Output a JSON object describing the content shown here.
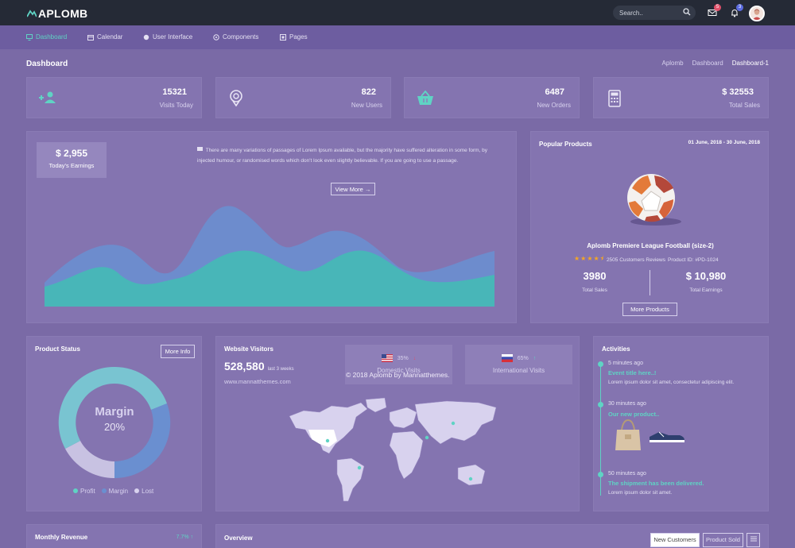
{
  "brand": {
    "name": "APLOMB"
  },
  "search": {
    "placeholder": "Search.."
  },
  "notifications": {
    "mail_count": "5",
    "bell_count": "3"
  },
  "nav": [
    {
      "label": "Dashboard",
      "icon": "monitor-icon"
    },
    {
      "label": "Calendar",
      "icon": "calendar-icon"
    },
    {
      "label": "User Interface",
      "icon": "circle-icon"
    },
    {
      "label": "Components",
      "icon": "gauge-icon"
    },
    {
      "label": "Pages",
      "icon": "pages-icon"
    }
  ],
  "page": {
    "title": "Dashboard",
    "breadcrumbs": [
      "Aplomb",
      "Dashboard",
      "Dashboard-1"
    ]
  },
  "stats": [
    {
      "value": "15321",
      "label": "Visits Today",
      "icon": "user-add-icon"
    },
    {
      "value": "822",
      "label": "New Users",
      "icon": "pin-icon"
    },
    {
      "value": "6487",
      "label": "New Orders",
      "icon": "basket-icon"
    },
    {
      "value": "$ 32553",
      "label": "Total Sales",
      "icon": "calculator-icon"
    }
  ],
  "earnings": {
    "value": "$ 2,955",
    "label": "Today's Earnings",
    "text": "There are many variations of passages of Lorem Ipsum available, but the majority have suffered alteration in some form, by injected humour, or randomised words which don't look even slightly believable. If you are going to use a passage.",
    "button": "View More →"
  },
  "popular": {
    "title": "Popular Products",
    "date_range": "01 June, 2018 - 30 June, 2018",
    "product_name": "Aplomb Premiere League Football (size-2)",
    "reviews": "2505 Customers Reviews",
    "product_id": "Product ID: #PD-1024",
    "rating": 4.5,
    "sales_value": "3980",
    "sales_label": "Total Sales",
    "earnings_value": "$ 10,980",
    "earnings_label": "Total Earnings",
    "button": "More Products"
  },
  "product_status": {
    "title": "Product Status",
    "button": "More Info",
    "center_label": "Margin",
    "center_value": "20%",
    "legend": [
      {
        "label": "Profit",
        "color": "#5fd3c4"
      },
      {
        "label": "Margin",
        "color": "#6a8fd0"
      },
      {
        "label": "Lost",
        "color": "#d8d2ee"
      }
    ]
  },
  "visitors": {
    "title": "Website Visitors",
    "count": "528,580",
    "period": "last 3 weeks",
    "site": "www.mannatthemes.com",
    "watermark": "© 2018 Aplomb by Mannatthemes.",
    "domestic": {
      "pct": "35%",
      "arrow": "↓",
      "label": "Domestic Visits"
    },
    "international": {
      "pct": "65%",
      "arrow": "↑",
      "label": "International Visits"
    }
  },
  "activities": {
    "title": "Activities",
    "items": [
      {
        "time": "5 minutes ago",
        "title": "Event title here..!",
        "text": "Lorem ipsum dolor sit amet, consectetur adipiscing elit."
      },
      {
        "time": "30 minutes ago",
        "title": "Our new product..",
        "text": ""
      },
      {
        "time": "50 minutes ago",
        "title": "The shipment has been delivered.",
        "text": "Lorem ipsum dolor sit amet."
      }
    ]
  },
  "revenue": {
    "title": "Monthly Revenue",
    "change": "7.7% ↑"
  },
  "overview": {
    "title": "Overview",
    "tabs": [
      "New Customers",
      "Product Sold"
    ]
  },
  "colors": {
    "accent": "#5fd3c4",
    "topbar": "#252a36",
    "nav": "#6d5da0",
    "bg": "#7a6aa6",
    "mail_badge": "#e0506a",
    "bell_badge": "#5b6be0"
  }
}
